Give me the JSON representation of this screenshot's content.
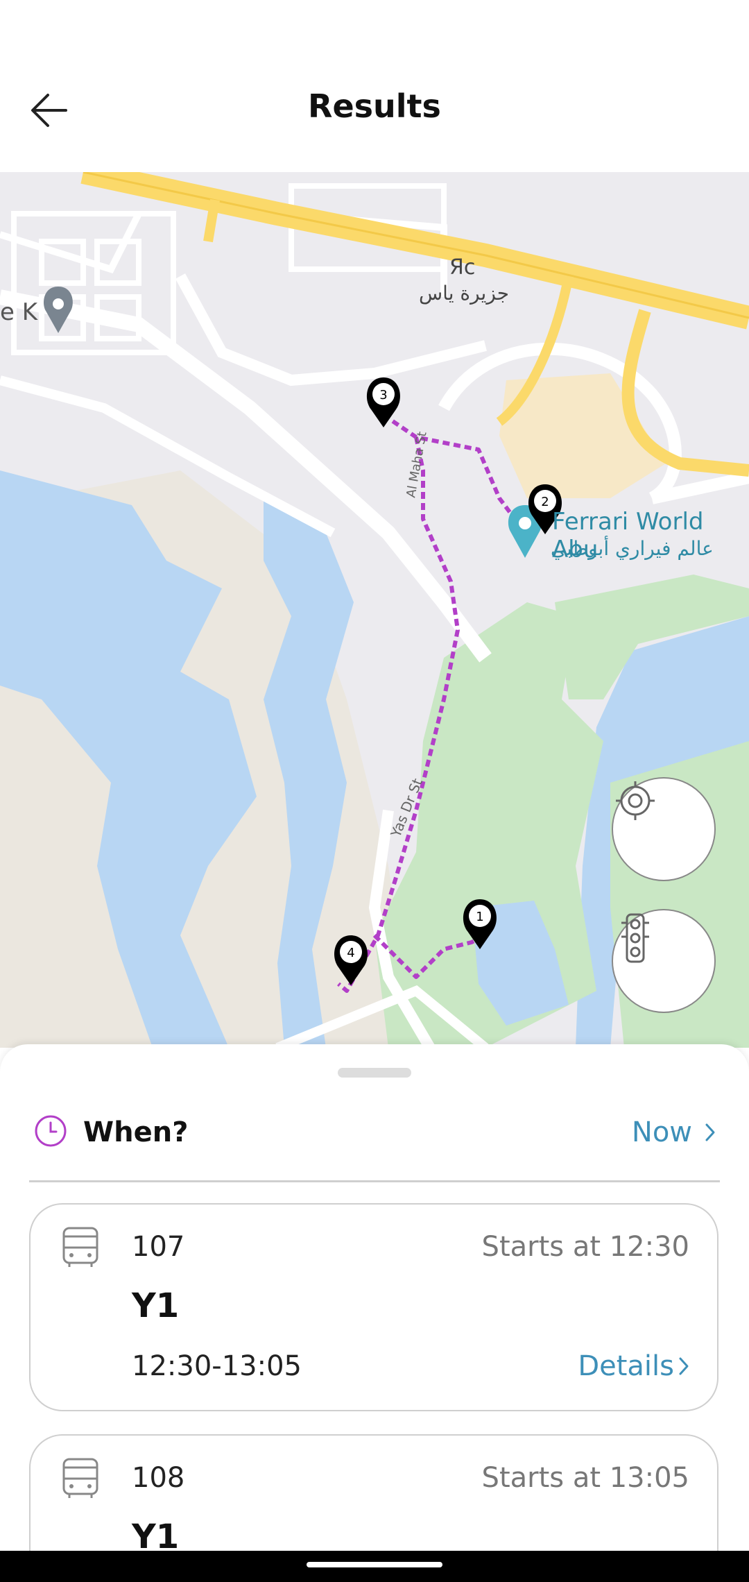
{
  "header": {
    "title": "Results",
    "back_icon": "arrow-left-icon"
  },
  "map": {
    "labels": {
      "area_latin": "Яс",
      "area_arabic": "جزيرة ياس",
      "poi_left": "e K",
      "ferrari_en": "Ferrari World Abu",
      "ferrari_ar": "عالم فيراري أبوظبي",
      "street_al_maha": "Al Maha St",
      "street_yas": "Yas Dr St"
    },
    "markers": [
      "1",
      "2",
      "3",
      "4"
    ],
    "route_color": "#b23fc8",
    "locate_button_icon": "crosshair-icon",
    "traffic_button_icon": "traffic-light-icon"
  },
  "when": {
    "label": "When?",
    "value": "Now",
    "icon": "clock-icon"
  },
  "trips": [
    {
      "route_number": "107",
      "start_time": "Starts at 12:30",
      "line_name": "Y1",
      "time_range": "12:30-13:05",
      "details_label": "Details"
    },
    {
      "route_number": "108",
      "start_time": "Starts at 13:05",
      "line_name": "Y1"
    }
  ],
  "colors": {
    "accent": "#3d8fb8",
    "clock_icon": "#b23fc8",
    "water": "#b8d6f3",
    "park": "#c9e7c4",
    "highway": "#fbd96a"
  }
}
